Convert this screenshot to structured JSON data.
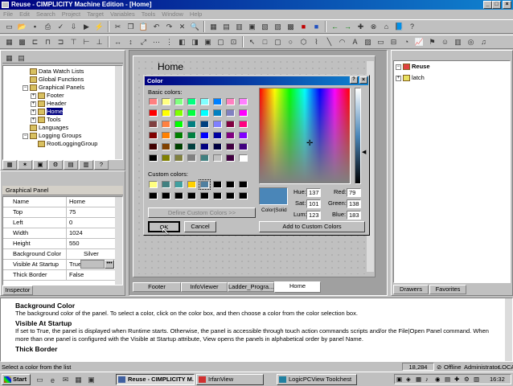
{
  "window": {
    "title": "Reuse - CIMPLICITY Machine Edition - [Home]"
  },
  "menu": [
    "File",
    "Edit",
    "Search",
    "Project",
    "Target",
    "Variables",
    "Tools",
    "Window",
    "Help"
  ],
  "tree": {
    "items": [
      {
        "label": "Data Watch Lists",
        "indent": 0,
        "expander": ""
      },
      {
        "label": "Global Functions",
        "indent": 0,
        "expander": ""
      },
      {
        "label": "Graphical Panels",
        "indent": 0,
        "expander": "-"
      },
      {
        "label": "Footer",
        "indent": 1,
        "expander": "+"
      },
      {
        "label": "Header",
        "indent": 1,
        "expander": "+"
      },
      {
        "label": "Home",
        "indent": 1,
        "expander": "+",
        "selected": true
      },
      {
        "label": "Tools",
        "indent": 1,
        "expander": "+"
      },
      {
        "label": "Languages",
        "indent": 0,
        "expander": ""
      },
      {
        "label": "Logging Groups",
        "indent": 0,
        "expander": "-"
      },
      {
        "label": "RootLoggingGroup",
        "indent": 1,
        "expander": ""
      }
    ]
  },
  "inspector": {
    "header": "Graphical Panel",
    "rows": [
      {
        "key": "Name",
        "value": "Home"
      },
      {
        "key": "Top",
        "value": "75"
      },
      {
        "key": "Left",
        "value": "0"
      },
      {
        "key": "Width",
        "value": "1024"
      },
      {
        "key": "Height",
        "value": "550"
      },
      {
        "key": "Background Color",
        "value": "Silver"
      },
      {
        "key": "Visible At Startup",
        "value": "True"
      },
      {
        "key": "Thick Border",
        "value": "False"
      }
    ],
    "tab": "Inspector"
  },
  "panel_editor": {
    "title": "Home",
    "tabs": [
      "Footer",
      "InfoViewer",
      "Ladder_Progra...",
      "Home"
    ],
    "active_tab": "Home"
  },
  "color_dialog": {
    "title": "Color",
    "basic_label": "Basic colors:",
    "custom_label": "Custom colors:",
    "basic_colors": [
      "#ff8080",
      "#ffff80",
      "#80ff80",
      "#00ff80",
      "#80ffff",
      "#0080ff",
      "#ff80c0",
      "#ff80ff",
      "#ff0000",
      "#ffff00",
      "#80ff00",
      "#00ff40",
      "#00ffff",
      "#0080c0",
      "#8080c0",
      "#ff00ff",
      "#804040",
      "#ff8040",
      "#00ff00",
      "#008080",
      "#004080",
      "#8080ff",
      "#800040",
      "#ff0080",
      "#800000",
      "#ff8000",
      "#008000",
      "#008040",
      "#0000ff",
      "#0000a0",
      "#800080",
      "#8000ff",
      "#400000",
      "#804000",
      "#004000",
      "#004040",
      "#000080",
      "#000040",
      "#400040",
      "#400080",
      "#000000",
      "#808000",
      "#808040",
      "#808080",
      "#408080",
      "#c0c0c0",
      "#400040",
      "#ffffff"
    ],
    "custom_colors": [
      "#ffff80",
      "#408080",
      "#40a0a0",
      "#ffd000",
      "#5080a0",
      "#000000",
      "#000000",
      "#000000",
      "#000000",
      "#000000",
      "#000000",
      "#000000",
      "#000000",
      "#000000",
      "#000000",
      "#000000"
    ],
    "define_button": "Define Custom Colors >>",
    "ok_button": "OK",
    "cancel_button": "Cancel",
    "add_button": "Add to Custom Colors",
    "color_solid_label": "Color|Solid",
    "preview_color": "#4a86b8",
    "hue_label": "Hue:",
    "hue": "137",
    "sat_label": "Sat:",
    "sat": "101",
    "lum_label": "Lum:",
    "lum": "123",
    "red_label": "Red:",
    "red": "79",
    "green_label": "Green:",
    "green": "138",
    "blue_label": "Blue:",
    "blue": "183"
  },
  "right_panel": {
    "root": "Reuse",
    "child": "latch",
    "tabs": [
      "Drawers",
      "Favorites"
    ]
  },
  "help": {
    "sections": [
      {
        "heading": "Background Color",
        "text": "The background color of the panel. To select a color, click on the color box, and then choose a color from the color selection box."
      },
      {
        "heading": "Visible At Startup",
        "text": "If set to True, the panel is displayed when Runtime starts. Otherwise, the panel is accessible through touch action commands scripts and/or the File|Open Panel command. When more than one panel is configured with the Visible at Startup attribute, View opens the panels in alphabetical order by panel Name."
      },
      {
        "heading": "Thick Border",
        "text": ""
      }
    ]
  },
  "status": {
    "message": "Select a color from the list",
    "coords": "18,284",
    "offline": "Offline",
    "user": "Administrator",
    "mode": "LOCAL"
  },
  "taskbar": {
    "start": "Start",
    "tasks": [
      "Reuse - CIMPLICITY M...",
      "IrfanView",
      "LogicPCView Toolchest"
    ],
    "clock": "16:32"
  }
}
